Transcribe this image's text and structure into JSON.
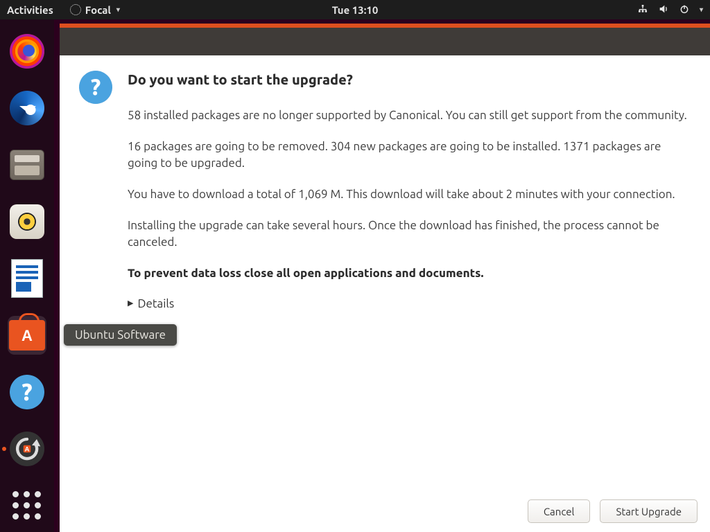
{
  "topbar": {
    "activities": "Activities",
    "appmenu_label": "Focal",
    "clock": "Tue 13:10"
  },
  "dock": {
    "tooltip": "Ubuntu Software"
  },
  "dialog": {
    "title": "Do you want to start the upgrade?",
    "para1": "58 installed packages are no longer supported by Canonical. You can still get support from the community.",
    "para2": "16 packages are going to be removed. 304 new packages are going to be installed. 1371 packages are going to be upgraded.",
    "para3": "You have to download a total of 1,069 M. This download will take about 2 minutes with your connection.",
    "para4": "Installing the upgrade can take several hours. Once the download has finished, the process cannot be canceled.",
    "para5_bold": "To prevent data loss close all open applications and documents.",
    "details_label": "Details",
    "cancel": "Cancel",
    "start": "Start Upgrade"
  }
}
